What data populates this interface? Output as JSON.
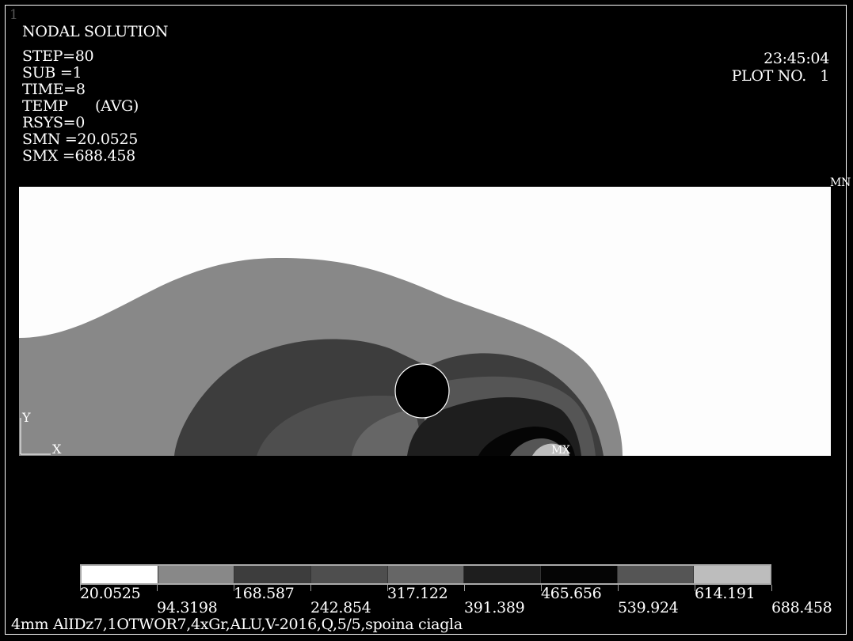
{
  "window": {
    "number": "1"
  },
  "header": {
    "solution_type": "NODAL SOLUTION",
    "step": "STEP=80",
    "sub": "SUB =1",
    "time": "TIME=8",
    "temp": "TEMP      (AVG)",
    "rsys": "RSYS=0",
    "smn": "SMN =20.0525",
    "smx": "SMX =688.458"
  },
  "plot_info": {
    "clock": "23:45:04",
    "plot_no": "PLOT NO.   1"
  },
  "markers": {
    "mn": "MN",
    "mx": "MX",
    "axis_y": "Y",
    "axis_x": "X"
  },
  "legend": {
    "colors": [
      "#ffffff",
      "#888888",
      "#3d3d3d",
      "#4e4e4e",
      "#666666",
      "#1e1e1e",
      "#050505",
      "#555555",
      "#bdbdbd"
    ],
    "labels_top": [
      "20.0525",
      "168.587",
      "317.122",
      "465.656",
      "614.191"
    ],
    "labels_bottom": [
      "94.3198",
      "242.854",
      "391.389",
      "539.924",
      "688.458"
    ]
  },
  "footer": {
    "title": "4mm AlIDz7,1OTWOR7,4xGr,ALU,V-2016,Q,5/5,spoina ciagla"
  }
}
